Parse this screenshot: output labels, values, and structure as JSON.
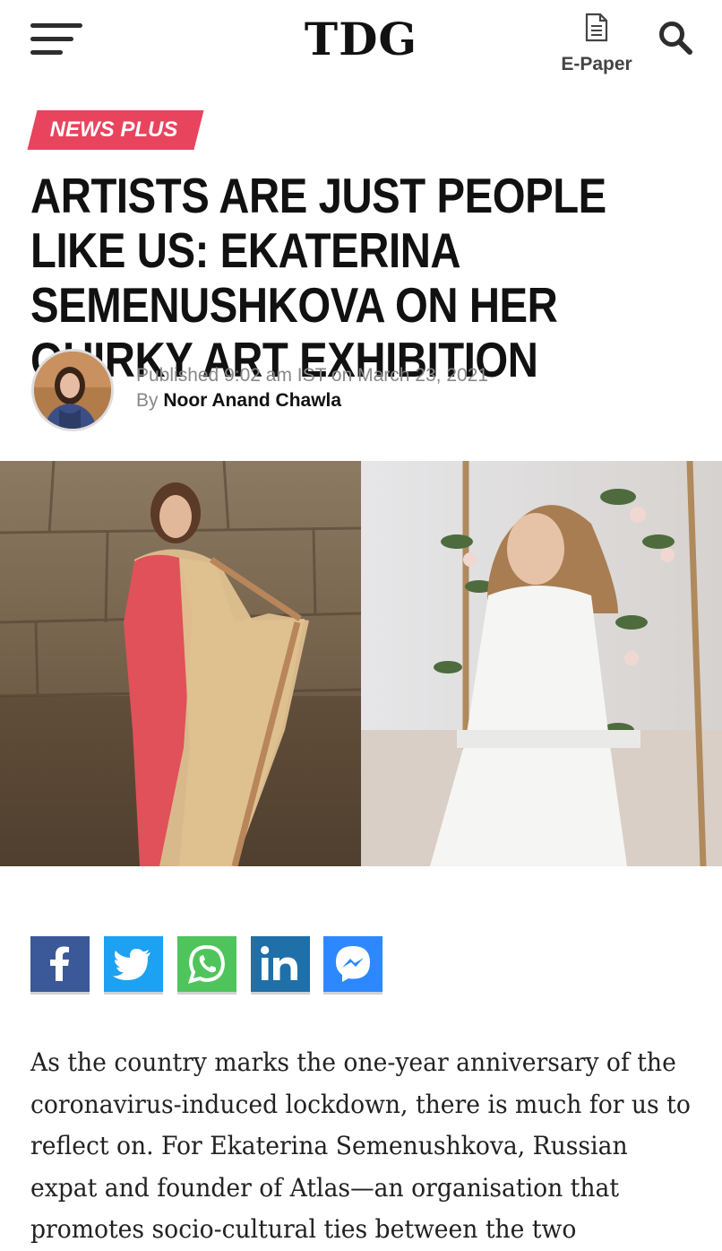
{
  "header": {
    "logo": "TDG",
    "epaper_label": "E-Paper",
    "icons": [
      "hamburger-menu-icon",
      "document-icon",
      "search-icon"
    ]
  },
  "article": {
    "category": "NEWS PLUS",
    "headline": "ARTISTS ARE JUST PEOPLE LIKE US: EKATERINA SEMENUSHKOVA ON HER QUIRKY ART EXHIBITION",
    "published_prefix": "Published ",
    "published_time": "9:02 am IST",
    "published_on": " on ",
    "published_date": "March 23, 2021",
    "by_prefix": "By ",
    "author": "Noor Anand Chawla",
    "body_intro": "As the country marks the one-year anniversary of the coronavirus-induced lockdown, there is much for us to reflect on. For Ekaterina Semenushkova, Russian expat and founder of Atlas—an organisation that promotes socio-cultural ties between the two"
  },
  "share": [
    {
      "network": "facebook",
      "icon": "facebook-icon",
      "color": "#3b5998"
    },
    {
      "network": "twitter",
      "icon": "twitter-icon",
      "color": "#1da1f2"
    },
    {
      "network": "whatsapp",
      "icon": "whatsapp-icon",
      "color": "#4fc45c"
    },
    {
      "network": "linkedin",
      "icon": "linkedin-icon",
      "color": "#1f6fa8"
    },
    {
      "network": "messenger",
      "icon": "messenger-icon",
      "color": "#2d88ff"
    }
  ],
  "colors": {
    "category_tag": "#e8445e",
    "text": "#111111",
    "meta": "#888888"
  }
}
